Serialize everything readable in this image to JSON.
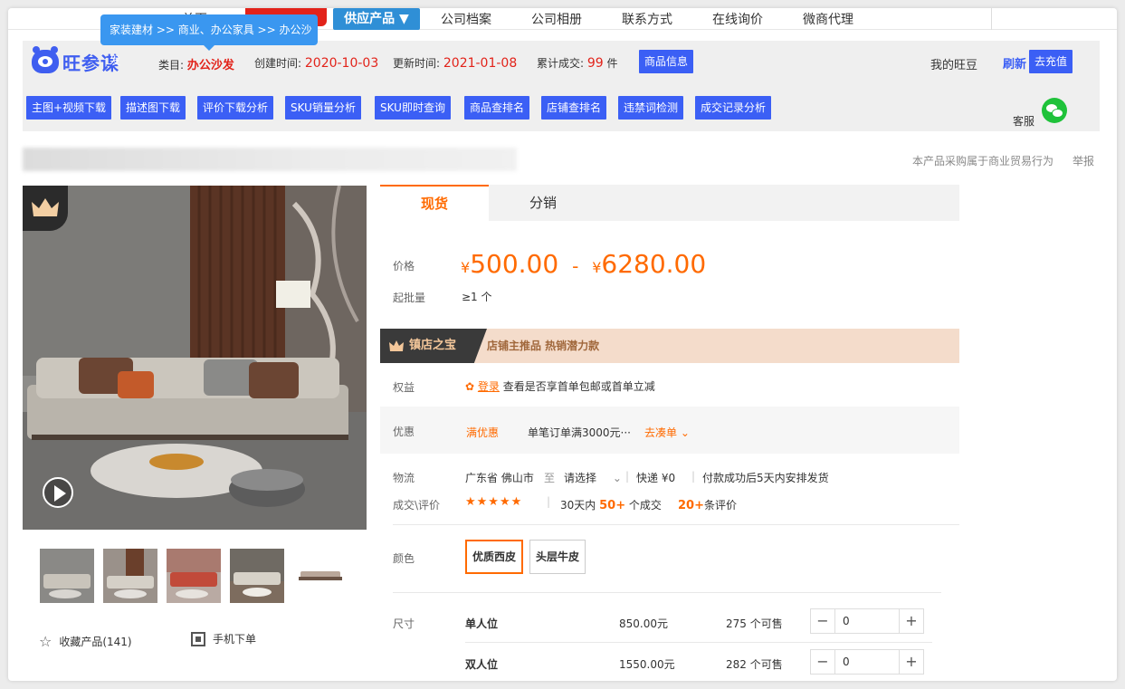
{
  "topnav": {
    "home": "首页",
    "supply": "供应产品 ▼",
    "items": [
      "公司档案",
      "公司相册",
      "联系方式",
      "在线询价",
      "微商代理"
    ]
  },
  "tooltip": "家装建材 >> 商业、办公家具 >> 办公沙发",
  "plugin": {
    "logo": "旺参谋",
    "category_label": "类目:",
    "category": "办公沙发",
    "created_label": "创建时间:",
    "created": "2020-10-03",
    "updated_label": "更新时间:",
    "updated": "2021-01-08",
    "sales_label": "累计成交:",
    "sales": "99",
    "sales_unit": "件",
    "product_info": "商品信息",
    "wangdou": "我的旺豆",
    "refresh": "刷新",
    "recharge": "去充值",
    "tools": [
      "主图+视频下载",
      "描述图下载",
      "评价下载分析",
      "SKU销量分析",
      "SKU即时查询",
      "商品查排名",
      "店铺查排名",
      "违禁词检测",
      "成交记录分析"
    ],
    "kefu": "客服"
  },
  "notice": {
    "trade": "本产品采购属于商业贸易行为",
    "report": "举报"
  },
  "gallery": {
    "favorite": "收藏产品(141)",
    "mobile": "手机下单"
  },
  "tabs": [
    "现货",
    "分销"
  ],
  "price": {
    "label": "价格",
    "currency": "¥",
    "low": "500.00",
    "sep": "-",
    "high": "6280.00",
    "moq_label": "起批量",
    "moq": "≥1 个"
  },
  "treasure": {
    "title": "镇店之宝",
    "tags": "店铺主推品   热销潜力款"
  },
  "rights": {
    "label": "权益",
    "login": "登录",
    "text": "查看是否享首单包邮或首单立减"
  },
  "promo": {
    "label": "优惠",
    "tag": "满优惠",
    "text": "单笔订单满3000元···",
    "link": "去凑单"
  },
  "logistics": {
    "label": "物流",
    "from": "广东省 佛山市",
    "to_label": "至",
    "to": "请选择",
    "express": "快递 ¥0",
    "ship": "付款成功后5天内安排发货"
  },
  "deals": {
    "label": "成交\\评价",
    "stars": "★★★★★",
    "d30_a": "30天内",
    "d30_n": "50+",
    "d30_b": "个成交",
    "rev_n": "20+",
    "rev_b": "条评价"
  },
  "color": {
    "label": "颜色",
    "options": [
      "优质西皮",
      "头层牛皮"
    ]
  },
  "size": {
    "label": "尺寸",
    "rows": [
      {
        "name": "单人位",
        "price": "850.00元",
        "stock": "275 个可售",
        "qty": "0"
      },
      {
        "name": "双人位",
        "price": "1550.00元",
        "stock": "282 个可售",
        "qty": "0"
      }
    ]
  },
  "colors": {
    "accent": "#ff6a00",
    "plugin_blue": "#3b5ff5",
    "brand_red": "#e2231a"
  }
}
